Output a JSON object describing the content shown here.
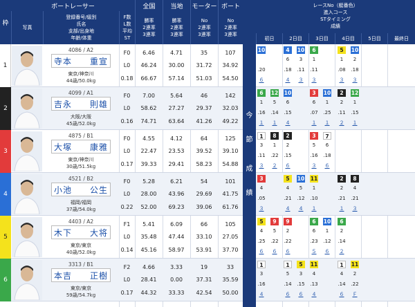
{
  "header": {
    "waku": "枠",
    "boatracer": "ボートレーサー",
    "zenkoku": "全国",
    "touchi": "当地",
    "motor": "モーター",
    "boat": "ボート",
    "photo": "写真",
    "racer_cols": [
      "登録番号/級別",
      "氏名",
      "支部/出身地",
      "年齢/体重"
    ],
    "flst": [
      "F数",
      "L数",
      "平均ST"
    ],
    "zenkoku_sub": [
      "勝率",
      "2連率",
      "3連率"
    ],
    "touchi_sub": [
      "勝率",
      "2連率",
      "3連率"
    ],
    "motor_sub": [
      "No",
      "2連率",
      "3連率"
    ],
    "boat_sub": [
      "No",
      "2連率",
      "3連率"
    ],
    "right": [
      "レースNo（艇番色）",
      "進入コース",
      "STタイミング",
      "成績"
    ],
    "days": [
      "初日",
      "2日目",
      "3日目",
      "4日目",
      "5日目",
      "最終日"
    ]
  },
  "middle_label": [
    "今",
    "節",
    "成",
    "績"
  ],
  "colors": {
    "navy": "#1b3a7a",
    "waku": [
      "#ffffff",
      "#222222",
      "#e23b3b",
      "#2a6fd6",
      "#f4e21c",
      "#3aa84a"
    ],
    "waku_text": [
      "#222222",
      "#ffffff",
      "#ffffff",
      "#ffffff",
      "#222222",
      "#ffffff"
    ],
    "lane_bg": {
      "1": "#ffffff",
      "2": "#222222",
      "3": "#e23b3b",
      "4": "#2a6fd6",
      "5": "#f4e21c",
      "6": "#3aa84a"
    },
    "lane_fg": {
      "1": "#222222",
      "2": "#ffffff",
      "3": "#ffffff",
      "4": "#ffffff",
      "5": "#222222",
      "6": "#ffffff"
    }
  },
  "racers": [
    {
      "waku": "1",
      "reg": "4086 / A2",
      "name": "寺本　　重宣",
      "branch": "東京/神奈川",
      "age": "44歳/50.0kg",
      "flst": [
        "F0",
        "L0",
        "0.18"
      ],
      "zenkoku": [
        "6.46",
        "46.24",
        "66.67"
      ],
      "touchi": [
        "4.71",
        "30.00",
        "57.14"
      ],
      "motor": [
        "35",
        "31.72",
        "51.03"
      ],
      "boat": [
        "107",
        "34.92",
        "54.50"
      ],
      "results": {
        "lanes": [
          {
            "v": "10",
            "c": 0
          },
          {
            "v": "4",
            "c": 2
          },
          {
            "v": "10",
            "c": 3
          },
          {
            "v": "6",
            "c": 4
          },
          {
            "v": "5",
            "c": 6
          },
          {
            "v": "10",
            "c": 7
          }
        ],
        "r2": [
          {
            "v": "6",
            "c": 2
          },
          {
            "v": "3",
            "c": 3
          },
          {
            "v": "1",
            "c": 4
          },
          {
            "v": "1",
            "c": 6
          },
          {
            "v": "2",
            "c": 7
          }
        ],
        "r2b": [
          {
            "v": ".20",
            "c": 0
          },
          {
            "v": ".18",
            "c": 2
          },
          {
            "v": ".11",
            "c": 3
          },
          {
            "v": ".11",
            "c": 4
          },
          {
            "v": ".08",
            "c": 6
          },
          {
            "v": ".18",
            "c": 7
          }
        ],
        "r3": [
          {
            "v": "６",
            "c": 0
          },
          {
            "v": "４",
            "c": 2
          },
          {
            "v": "３",
            "c": 3
          },
          {
            "v": "３",
            "c": 4
          },
          {
            "v": "３",
            "c": 6
          },
          {
            "v": "３",
            "c": 7
          }
        ]
      }
    },
    {
      "waku": "2",
      "reg": "4099 / A1",
      "name": "吉永　　則雄",
      "branch": "大阪/大阪",
      "age": "45歳/52.0kg",
      "flst": [
        "F0",
        "L0",
        "0.16"
      ],
      "zenkoku": [
        "7.00",
        "58.62",
        "74.71"
      ],
      "touchi": [
        "5.64",
        "27.27",
        "63.64"
      ],
      "motor": [
        "46",
        "29.37",
        "41.26"
      ],
      "boat": [
        "142",
        "32.03",
        "49.22"
      ],
      "results": {
        "lanes": [
          {
            "v": "6",
            "c": 0
          },
          {
            "v": "12",
            "c": 1
          },
          {
            "v": "10",
            "c": 2
          },
          {
            "v": "3",
            "c": 4
          },
          {
            "v": "10",
            "c": 5
          },
          {
            "v": "2",
            "c": 6
          },
          {
            "v": "12",
            "c": 7
          }
        ],
        "r2": [
          {
            "v": "1",
            "c": 0
          },
          {
            "v": "5",
            "c": 1
          },
          {
            "v": "6",
            "c": 2
          },
          {
            "v": "6",
            "c": 4
          },
          {
            "v": "1",
            "c": 5
          },
          {
            "v": "2",
            "c": 6
          },
          {
            "v": "1",
            "c": 7
          }
        ],
        "r2b": [
          {
            "v": ".16",
            "c": 0
          },
          {
            "v": ".14",
            "c": 1
          },
          {
            "v": ".15",
            "c": 2
          },
          {
            "v": ".07",
            "c": 4
          },
          {
            "v": ".25",
            "c": 5
          },
          {
            "v": ".11",
            "c": 6
          },
          {
            "v": ".15",
            "c": 7
          }
        ],
        "r3": [
          {
            "v": "１",
            "c": 0
          },
          {
            "v": "１",
            "c": 1
          },
          {
            "v": "４",
            "c": 2
          },
          {
            "v": "１",
            "c": 4
          },
          {
            "v": "１",
            "c": 5
          },
          {
            "v": "２",
            "c": 6
          },
          {
            "v": "１",
            "c": 7
          }
        ]
      }
    },
    {
      "waku": "3",
      "reg": "4875 / B1",
      "name": "大塚　　康雅",
      "branch": "東京/神奈川",
      "age": "30歳/51.5kg",
      "flst": [
        "F0",
        "L0",
        "0.17"
      ],
      "zenkoku": [
        "4.55",
        "22.47",
        "39.33"
      ],
      "touchi": [
        "4.12",
        "23.53",
        "29.41"
      ],
      "motor": [
        "64",
        "39.52",
        "58.23"
      ],
      "boat": [
        "125",
        "39.10",
        "54.88"
      ],
      "results": {
        "lanes": [
          {
            "v": "1",
            "c": 0
          },
          {
            "v": "8",
            "c": 1
          },
          {
            "v": "2",
            "c": 2
          },
          {
            "v": "3",
            "c": 4
          },
          {
            "v": "7",
            "c": 5
          }
        ],
        "r2": [
          {
            "v": "3",
            "c": 0
          },
          {
            "v": "1",
            "c": 1
          },
          {
            "v": "2",
            "c": 2
          },
          {
            "v": "5",
            "c": 4
          },
          {
            "v": "6",
            "c": 5
          }
        ],
        "r2b": [
          {
            "v": ".11",
            "c": 0
          },
          {
            "v": ".22",
            "c": 1
          },
          {
            "v": ".15",
            "c": 2
          },
          {
            "v": ".16",
            "c": 4
          },
          {
            "v": ".18",
            "c": 5
          }
        ],
        "r3": [
          {
            "v": "３",
            "c": 0
          },
          {
            "v": "２",
            "c": 1
          },
          {
            "v": "６",
            "c": 2
          },
          {
            "v": "３",
            "c": 4
          },
          {
            "v": "６",
            "c": 5
          }
        ]
      }
    },
    {
      "waku": "4",
      "reg": "4521 / B2",
      "name": "小池　　公生",
      "branch": "福岡/福岡",
      "age": "37歳/54.0kg",
      "flst": [
        "F0",
        "L0",
        "0.22"
      ],
      "zenkoku": [
        "5.28",
        "28.00",
        "52.00"
      ],
      "touchi": [
        "6.21",
        "43.96",
        "69.23"
      ],
      "motor": [
        "54",
        "29.69",
        "39.06"
      ],
      "boat": [
        "101",
        "41.75",
        "61.76"
      ],
      "results": {
        "lanes": [
          {
            "v": "3",
            "c": 0
          },
          {
            "v": "5",
            "c": 2
          },
          {
            "v": "10",
            "c": 3
          },
          {
            "v": "11",
            "c": 4
          },
          {
            "v": "2",
            "c": 6
          },
          {
            "v": "8",
            "c": 7
          }
        ],
        "r2": [
          {
            "v": "4",
            "c": 0
          },
          {
            "v": "4",
            "c": 2
          },
          {
            "v": "5",
            "c": 3
          },
          {
            "v": "1",
            "c": 4
          },
          {
            "v": "2",
            "c": 6
          },
          {
            "v": "4",
            "c": 7
          }
        ],
        "r2b": [
          {
            "v": ".05",
            "c": 0
          },
          {
            "v": ".21",
            "c": 2
          },
          {
            "v": ".12",
            "c": 3
          },
          {
            "v": ".10",
            "c": 4
          },
          {
            "v": ".21",
            "c": 6
          },
          {
            "v": ".21",
            "c": 7
          }
        ],
        "r3": [
          {
            "v": "３",
            "c": 0
          },
          {
            "v": "４",
            "c": 2
          },
          {
            "v": "４",
            "c": 3
          },
          {
            "v": "１",
            "c": 4
          },
          {
            "v": "１",
            "c": 6
          },
          {
            "v": "３",
            "c": 7
          }
        ]
      }
    },
    {
      "waku": "5",
      "reg": "4403 / A2",
      "name": "木下　　大将",
      "branch": "東京/東京",
      "age": "40歳/52.0kg",
      "flst": [
        "F1",
        "L0",
        "0.14"
      ],
      "zenkoku": [
        "5.41",
        "35.48",
        "45.16"
      ],
      "touchi": [
        "6.09",
        "47.44",
        "58.97"
      ],
      "motor": [
        "66",
        "33.10",
        "53.91"
      ],
      "boat": [
        "105",
        "27.05",
        "37.70"
      ],
      "results": {
        "lanes": [
          {
            "v": "5",
            "c": 0
          },
          {
            "v": "9",
            "c": 1
          },
          {
            "v": "9",
            "c": 2
          },
          {
            "v": "6",
            "c": 4
          },
          {
            "v": "10",
            "c": 5
          },
          {
            "v": "6",
            "c": 6
          }
        ],
        "r2": [
          {
            "v": "4",
            "c": 0
          },
          {
            "v": "5",
            "c": 1
          },
          {
            "v": "2",
            "c": 2
          },
          {
            "v": "6",
            "c": 4
          },
          {
            "v": "1",
            "c": 5
          },
          {
            "v": "2",
            "c": 6
          }
        ],
        "r2b": [
          {
            "v": ".25",
            "c": 0
          },
          {
            "v": ".22",
            "c": 1
          },
          {
            "v": ".22",
            "c": 2
          },
          {
            "v": ".23",
            "c": 4
          },
          {
            "v": ".12",
            "c": 5
          },
          {
            "v": ".14",
            "c": 6
          }
        ],
        "r3": [
          {
            "v": "６",
            "c": 0
          },
          {
            "v": "６",
            "c": 1
          },
          {
            "v": "６",
            "c": 2
          },
          {
            "v": "５",
            "c": 4
          },
          {
            "v": "６",
            "c": 5
          },
          {
            "v": "２",
            "c": 6
          }
        ]
      }
    },
    {
      "waku": "6",
      "reg": "3313 / B1",
      "name": "本吉　　正樹",
      "branch": "東京/東京",
      "age": "59歳/54.7kg",
      "flst": [
        "F2",
        "L0",
        "0.17"
      ],
      "zenkoku": [
        "4.66",
        "28.41",
        "44.32"
      ],
      "touchi": [
        "3.33",
        "0.00",
        "33.33"
      ],
      "motor": [
        "19",
        "37.31",
        "42.54"
      ],
      "boat": [
        "33",
        "35.59",
        "50.00"
      ],
      "results": {
        "lanes": [
          {
            "v": "1",
            "c": 0
          },
          {
            "v": "1",
            "c": 2
          },
          {
            "v": "5",
            "c": 3
          },
          {
            "v": "11",
            "c": 4
          },
          {
            "v": "1",
            "c": 6
          },
          {
            "v": "11",
            "c": 7
          }
        ],
        "r2": [
          {
            "v": "3",
            "c": 0
          },
          {
            "v": "5",
            "c": 2
          },
          {
            "v": "3",
            "c": 3
          },
          {
            "v": "4",
            "c": 4
          },
          {
            "v": "4",
            "c": 6
          },
          {
            "v": "2",
            "c": 7
          }
        ],
        "r2b": [
          {
            "v": ".16",
            "c": 0
          },
          {
            "v": ".14",
            "c": 2
          },
          {
            "v": ".15",
            "c": 3
          },
          {
            "v": ".13",
            "c": 4
          },
          {
            "v": ".14",
            "c": 6
          },
          {
            "v": ".22",
            "c": 7
          }
        ],
        "r3": [
          {
            "v": "４",
            "c": 0
          },
          {
            "v": "６",
            "c": 2
          },
          {
            "v": "６",
            "c": 3
          },
          {
            "v": "４",
            "c": 4
          },
          {
            "v": "６",
            "c": 6
          },
          {
            "v": "Ｆ",
            "c": 7
          }
        ]
      }
    }
  ]
}
